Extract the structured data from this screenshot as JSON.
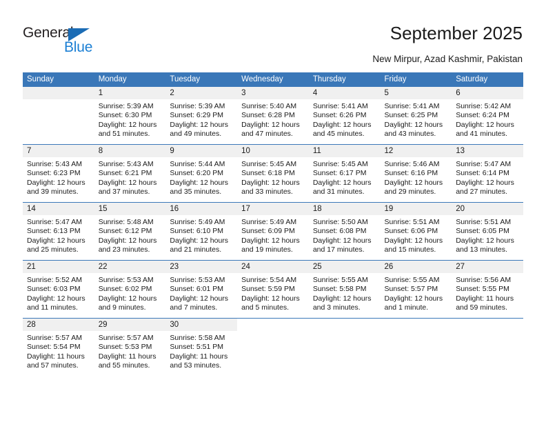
{
  "brand": {
    "name_part1": "General",
    "name_part2": "Blue",
    "accent_color": "#1b7fd4",
    "triangle_color": "#1b6cb5"
  },
  "header": {
    "title": "September 2025",
    "location": "New Mirpur, Azad Kashmir, Pakistan"
  },
  "theme": {
    "header_row_color": "#3a77b8",
    "daynum_background": "#f0f0f0",
    "text_color": "#1a1a1a"
  },
  "weekdays": [
    "Sunday",
    "Monday",
    "Tuesday",
    "Wednesday",
    "Thursday",
    "Friday",
    "Saturday"
  ],
  "weeks": [
    [
      {
        "day": "",
        "sunrise": "",
        "sunset": "",
        "daylight1": "",
        "daylight2": ""
      },
      {
        "day": "1",
        "sunrise": "Sunrise: 5:39 AM",
        "sunset": "Sunset: 6:30 PM",
        "daylight1": "Daylight: 12 hours",
        "daylight2": "and 51 minutes."
      },
      {
        "day": "2",
        "sunrise": "Sunrise: 5:39 AM",
        "sunset": "Sunset: 6:29 PM",
        "daylight1": "Daylight: 12 hours",
        "daylight2": "and 49 minutes."
      },
      {
        "day": "3",
        "sunrise": "Sunrise: 5:40 AM",
        "sunset": "Sunset: 6:28 PM",
        "daylight1": "Daylight: 12 hours",
        "daylight2": "and 47 minutes."
      },
      {
        "day": "4",
        "sunrise": "Sunrise: 5:41 AM",
        "sunset": "Sunset: 6:26 PM",
        "daylight1": "Daylight: 12 hours",
        "daylight2": "and 45 minutes."
      },
      {
        "day": "5",
        "sunrise": "Sunrise: 5:41 AM",
        "sunset": "Sunset: 6:25 PM",
        "daylight1": "Daylight: 12 hours",
        "daylight2": "and 43 minutes."
      },
      {
        "day": "6",
        "sunrise": "Sunrise: 5:42 AM",
        "sunset": "Sunset: 6:24 PM",
        "daylight1": "Daylight: 12 hours",
        "daylight2": "and 41 minutes."
      }
    ],
    [
      {
        "day": "7",
        "sunrise": "Sunrise: 5:43 AM",
        "sunset": "Sunset: 6:23 PM",
        "daylight1": "Daylight: 12 hours",
        "daylight2": "and 39 minutes."
      },
      {
        "day": "8",
        "sunrise": "Sunrise: 5:43 AM",
        "sunset": "Sunset: 6:21 PM",
        "daylight1": "Daylight: 12 hours",
        "daylight2": "and 37 minutes."
      },
      {
        "day": "9",
        "sunrise": "Sunrise: 5:44 AM",
        "sunset": "Sunset: 6:20 PM",
        "daylight1": "Daylight: 12 hours",
        "daylight2": "and 35 minutes."
      },
      {
        "day": "10",
        "sunrise": "Sunrise: 5:45 AM",
        "sunset": "Sunset: 6:18 PM",
        "daylight1": "Daylight: 12 hours",
        "daylight2": "and 33 minutes."
      },
      {
        "day": "11",
        "sunrise": "Sunrise: 5:45 AM",
        "sunset": "Sunset: 6:17 PM",
        "daylight1": "Daylight: 12 hours",
        "daylight2": "and 31 minutes."
      },
      {
        "day": "12",
        "sunrise": "Sunrise: 5:46 AM",
        "sunset": "Sunset: 6:16 PM",
        "daylight1": "Daylight: 12 hours",
        "daylight2": "and 29 minutes."
      },
      {
        "day": "13",
        "sunrise": "Sunrise: 5:47 AM",
        "sunset": "Sunset: 6:14 PM",
        "daylight1": "Daylight: 12 hours",
        "daylight2": "and 27 minutes."
      }
    ],
    [
      {
        "day": "14",
        "sunrise": "Sunrise: 5:47 AM",
        "sunset": "Sunset: 6:13 PM",
        "daylight1": "Daylight: 12 hours",
        "daylight2": "and 25 minutes."
      },
      {
        "day": "15",
        "sunrise": "Sunrise: 5:48 AM",
        "sunset": "Sunset: 6:12 PM",
        "daylight1": "Daylight: 12 hours",
        "daylight2": "and 23 minutes."
      },
      {
        "day": "16",
        "sunrise": "Sunrise: 5:49 AM",
        "sunset": "Sunset: 6:10 PM",
        "daylight1": "Daylight: 12 hours",
        "daylight2": "and 21 minutes."
      },
      {
        "day": "17",
        "sunrise": "Sunrise: 5:49 AM",
        "sunset": "Sunset: 6:09 PM",
        "daylight1": "Daylight: 12 hours",
        "daylight2": "and 19 minutes."
      },
      {
        "day": "18",
        "sunrise": "Sunrise: 5:50 AM",
        "sunset": "Sunset: 6:08 PM",
        "daylight1": "Daylight: 12 hours",
        "daylight2": "and 17 minutes."
      },
      {
        "day": "19",
        "sunrise": "Sunrise: 5:51 AM",
        "sunset": "Sunset: 6:06 PM",
        "daylight1": "Daylight: 12 hours",
        "daylight2": "and 15 minutes."
      },
      {
        "day": "20",
        "sunrise": "Sunrise: 5:51 AM",
        "sunset": "Sunset: 6:05 PM",
        "daylight1": "Daylight: 12 hours",
        "daylight2": "and 13 minutes."
      }
    ],
    [
      {
        "day": "21",
        "sunrise": "Sunrise: 5:52 AM",
        "sunset": "Sunset: 6:03 PM",
        "daylight1": "Daylight: 12 hours",
        "daylight2": "and 11 minutes."
      },
      {
        "day": "22",
        "sunrise": "Sunrise: 5:53 AM",
        "sunset": "Sunset: 6:02 PM",
        "daylight1": "Daylight: 12 hours",
        "daylight2": "and 9 minutes."
      },
      {
        "day": "23",
        "sunrise": "Sunrise: 5:53 AM",
        "sunset": "Sunset: 6:01 PM",
        "daylight1": "Daylight: 12 hours",
        "daylight2": "and 7 minutes."
      },
      {
        "day": "24",
        "sunrise": "Sunrise: 5:54 AM",
        "sunset": "Sunset: 5:59 PM",
        "daylight1": "Daylight: 12 hours",
        "daylight2": "and 5 minutes."
      },
      {
        "day": "25",
        "sunrise": "Sunrise: 5:55 AM",
        "sunset": "Sunset: 5:58 PM",
        "daylight1": "Daylight: 12 hours",
        "daylight2": "and 3 minutes."
      },
      {
        "day": "26",
        "sunrise": "Sunrise: 5:55 AM",
        "sunset": "Sunset: 5:57 PM",
        "daylight1": "Daylight: 12 hours",
        "daylight2": "and 1 minute."
      },
      {
        "day": "27",
        "sunrise": "Sunrise: 5:56 AM",
        "sunset": "Sunset: 5:55 PM",
        "daylight1": "Daylight: 11 hours",
        "daylight2": "and 59 minutes."
      }
    ],
    [
      {
        "day": "28",
        "sunrise": "Sunrise: 5:57 AM",
        "sunset": "Sunset: 5:54 PM",
        "daylight1": "Daylight: 11 hours",
        "daylight2": "and 57 minutes."
      },
      {
        "day": "29",
        "sunrise": "Sunrise: 5:57 AM",
        "sunset": "Sunset: 5:53 PM",
        "daylight1": "Daylight: 11 hours",
        "daylight2": "and 55 minutes."
      },
      {
        "day": "30",
        "sunrise": "Sunrise: 5:58 AM",
        "sunset": "Sunset: 5:51 PM",
        "daylight1": "Daylight: 11 hours",
        "daylight2": "and 53 minutes."
      },
      {
        "day": "",
        "sunrise": "",
        "sunset": "",
        "daylight1": "",
        "daylight2": ""
      },
      {
        "day": "",
        "sunrise": "",
        "sunset": "",
        "daylight1": "",
        "daylight2": ""
      },
      {
        "day": "",
        "sunrise": "",
        "sunset": "",
        "daylight1": "",
        "daylight2": ""
      },
      {
        "day": "",
        "sunrise": "",
        "sunset": "",
        "daylight1": "",
        "daylight2": ""
      }
    ]
  ]
}
